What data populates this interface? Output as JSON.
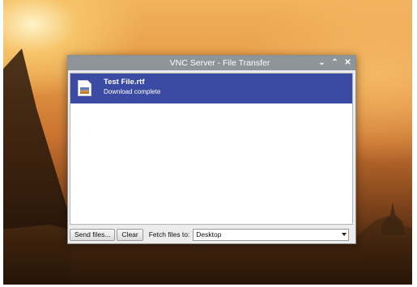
{
  "window": {
    "title": "VNC Server - File Transfer",
    "controls": {
      "minimize": "⌄",
      "maximize": "⌃",
      "close": "✕"
    }
  },
  "transfers": [
    {
      "name": "Test File.rtf",
      "status": "Download complete",
      "icon": "document-icon"
    }
  ],
  "toolbar": {
    "send_label": "Send files...",
    "clear_label": "Clear",
    "fetch_label": "Fetch files to:",
    "fetch_destination": "Desktop"
  },
  "colors": {
    "selection": "#3b4aa2",
    "titlebar": "#8d949a"
  }
}
